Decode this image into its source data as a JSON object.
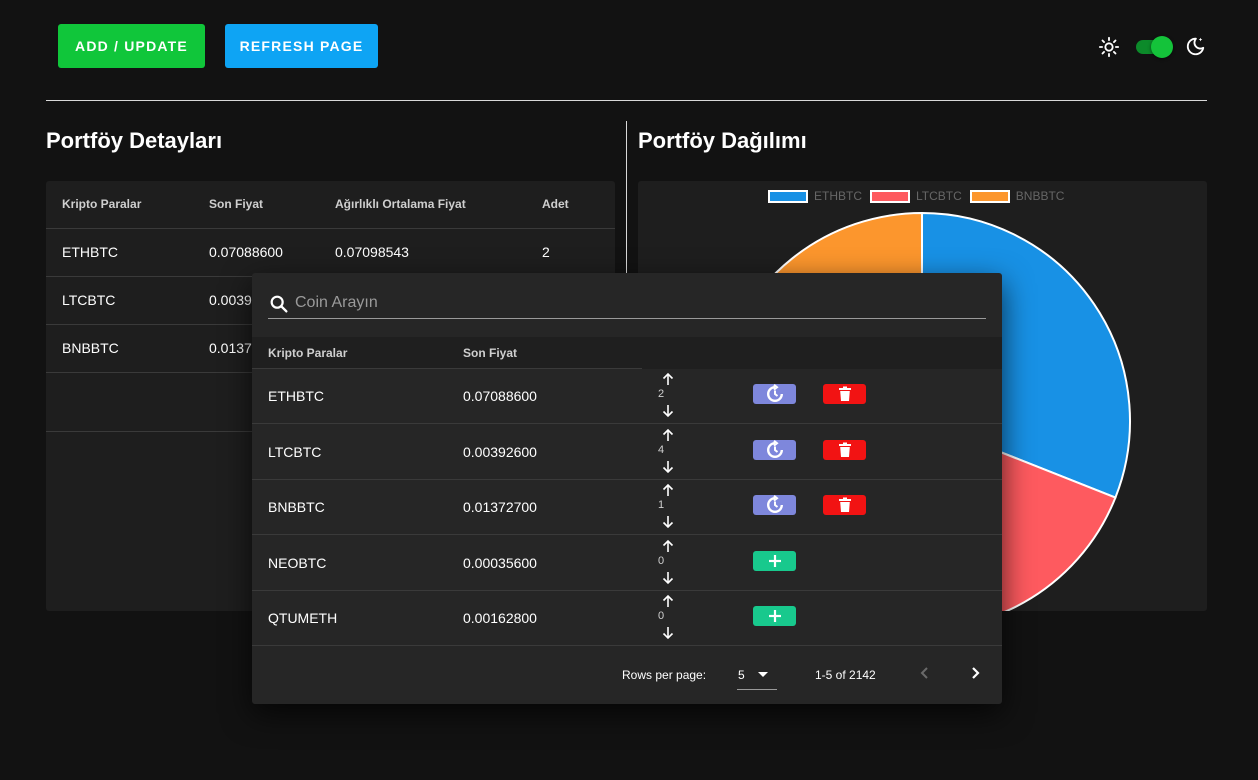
{
  "toolbar": {
    "add_label": "ADD / UPDATE",
    "refresh_label": "REFRESH PAGE"
  },
  "theme": {
    "dark_mode": true,
    "icons": [
      "sun-icon",
      "moon-icon"
    ]
  },
  "details": {
    "title": "Portföy Detayları",
    "columns": [
      "Kripto Paralar",
      "Son Fiyat",
      "Ağırlıklı Ortalama Fiyat",
      "Adet"
    ],
    "rows": [
      [
        "ETHBTC",
        "0.07088600",
        "0.07098543",
        "2"
      ],
      [
        "LTCBTC",
        "0.0039",
        "",
        ""
      ],
      [
        "BNBBTC",
        "0.0137",
        "",
        ""
      ]
    ]
  },
  "distribution": {
    "title": "Portföy Dağılımı",
    "legend": [
      "ETHBTC",
      "LTCBTC",
      "BNBBTC"
    ]
  },
  "chart_data": {
    "type": "pie",
    "labels": [
      "ETHBTC",
      "LTCBTC",
      "BNBBTC"
    ],
    "values": [
      31,
      26,
      43
    ],
    "colors": [
      "#1891e5",
      "#fe5a5f",
      "#fc962d"
    ]
  },
  "dialog": {
    "search_placeholder": "Coin Arayın",
    "columns": [
      "Kripto Paralar",
      "Son Fiyat"
    ],
    "rows": [
      {
        "coin": "ETHBTC",
        "price": "0.07088600",
        "qty": "2",
        "owned": true
      },
      {
        "coin": "LTCBTC",
        "price": "0.00392600",
        "qty": "4",
        "owned": true
      },
      {
        "coin": "BNBBTC",
        "price": "0.01372700",
        "qty": "1",
        "owned": true
      },
      {
        "coin": "NEOBTC",
        "price": "0.00035600",
        "qty": "0",
        "owned": false
      },
      {
        "coin": "QTUMETH",
        "price": "0.00162800",
        "qty": "0",
        "owned": false
      }
    ],
    "pagination": {
      "rows_per_page_label": "Rows per page:",
      "rows_per_page": "5",
      "range": "1-5 of 2142"
    }
  }
}
